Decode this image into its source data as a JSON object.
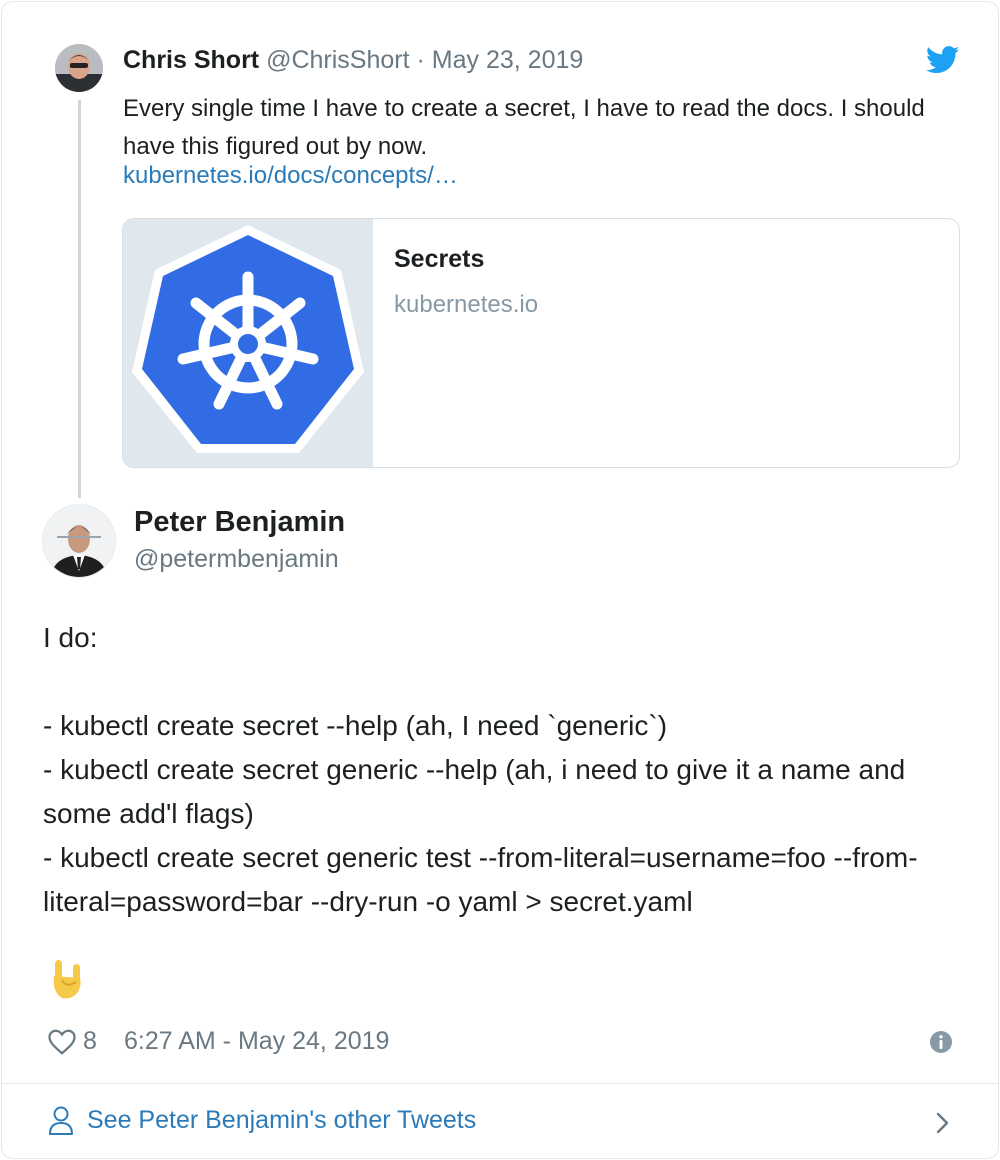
{
  "quoted_tweet": {
    "author_name": "Chris Short",
    "author_handle": "@ChrisShort",
    "separator": "·",
    "date": "May 23, 2019",
    "text": "Every single time I have to create a secret, I have to read the docs. I should have this figured out by now.",
    "link": "kubernetes.io/docs/concepts/…",
    "link_card": {
      "title": "Secrets",
      "domain": "kubernetes.io"
    }
  },
  "main_tweet": {
    "author_name": "Peter Benjamin",
    "author_handle": "@petermbenjamin",
    "text": "I do:\n\n- kubectl create secret --help (ah, I need `generic`)\n- kubectl create secret generic --help (ah, i need to give it a name and some add'l flags)\n- kubectl create secret generic test --from-literal=username=foo --from-literal=password=bar --dry-run -o yaml > secret.yaml",
    "like_count": "8",
    "timestamp": "6:27 AM - May 24, 2019"
  },
  "footer": {
    "see_more_label": "See Peter Benjamin's other Tweets"
  },
  "icons": {
    "brand": "twitter-bird-icon",
    "card_logo": "kubernetes-logo",
    "emoji": "sign-of-the-horns-emoji",
    "like": "heart-icon",
    "info": "info-icon",
    "profile": "person-icon",
    "navigate": "chevron-right-icon"
  },
  "colors": {
    "link": "#2b7bb9",
    "twitter_blue": "#1da1f2",
    "kubernetes_blue": "#326ce5",
    "muted_text": "#697882",
    "border": "#e1e8ed"
  }
}
